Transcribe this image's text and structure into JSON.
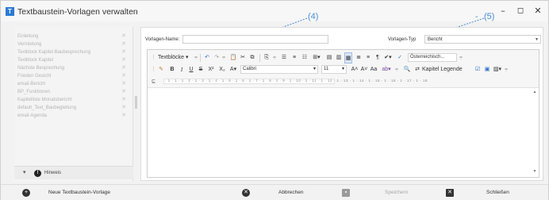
{
  "window": {
    "title": "Textbaustein-Vorlagen verwalten",
    "controls": {
      "minimize": "–",
      "maximize": "◻",
      "close": "✕"
    }
  },
  "annotations": {
    "a4": "(4)",
    "a5": "(5)",
    "color": "#4a8fd6"
  },
  "list": {
    "items": [
      {
        "label": "Einleitung"
      },
      {
        "label": "Vermietung"
      },
      {
        "label": "Textblock Kapitel Baubesprechung"
      },
      {
        "label": "Textblock Kapitel"
      },
      {
        "label": "Nächste Besprechung"
      },
      {
        "label": "Frieden Gesicht"
      },
      {
        "label": "email-Bericht"
      },
      {
        "label": "BP_Funktionen"
      },
      {
        "label": "Kapitelliste Monatsbericht"
      },
      {
        "label": "default_Text_Baubegleitung"
      },
      {
        "label": "email-Agenda"
      }
    ],
    "delete_glyph": "✕"
  },
  "hint": {
    "label": "Hinweis",
    "icon_glyph": "!",
    "chevron": "▾"
  },
  "form": {
    "name_label": "Vorlagen-Name:",
    "name_value": "",
    "type_label": "Vorlagen-Typ",
    "type_value": "Bericht",
    "type_arrow": "▾"
  },
  "toolbar": {
    "textbloecke": "Textblöcke",
    "font": "Calibri",
    "size": "11",
    "language": "Österreichisch...",
    "kapitel_legende": "Kapitel Legende"
  },
  "ruler": {
    "icon": "⊑",
    "text": "· 1 · 1 · 1 · 2 · 1 · 3 · 1 · 4 · 1 · 5 · 1 · 6 · 1 · 7 · 1 · 8 · 1 · 9 · 1 · 10 · 1 · 11 · 1 · 12 · 1 · 13 · 1 · 14 · 1 · 15 · 1 · 16 · 1 · 17 · 1 · 18"
  },
  "bottom": {
    "new_label": "Neue Textbaustein-Vorlage",
    "cancel_label": "Abbrechen",
    "save_label": "Speichern",
    "close_label": "Schließen"
  }
}
